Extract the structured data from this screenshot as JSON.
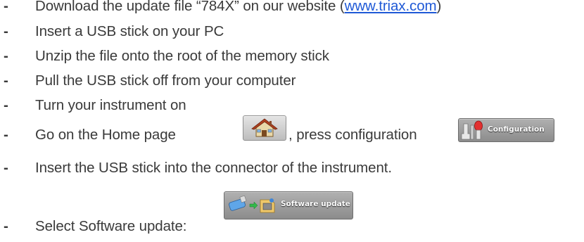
{
  "bullet": "-",
  "steps": [
    {
      "pre": "Download the update file “784X” on our website (",
      "link": "www.triax.com",
      "post": ")"
    },
    {
      "text": "Insert a USB stick on your PC"
    },
    {
      "text": "Unzip the file onto the root of the memory stick"
    },
    {
      "text": "Pull the USB stick off from your computer"
    },
    {
      "text": "Turn your instrument on"
    },
    {
      "pre": "Go on the Home page ",
      "mid": ", press configuration"
    },
    {
      "text": "Insert the USB stick into the connector of the instrument."
    },
    {
      "text": "Select Software update: "
    }
  ],
  "buttons": {
    "home_icon": "house-icon",
    "configuration_label": "Configuration",
    "configuration_icon": "wrench-tools-icon",
    "software_update_label": "Software update",
    "software_update_icon": "usb-to-folder-icon"
  }
}
